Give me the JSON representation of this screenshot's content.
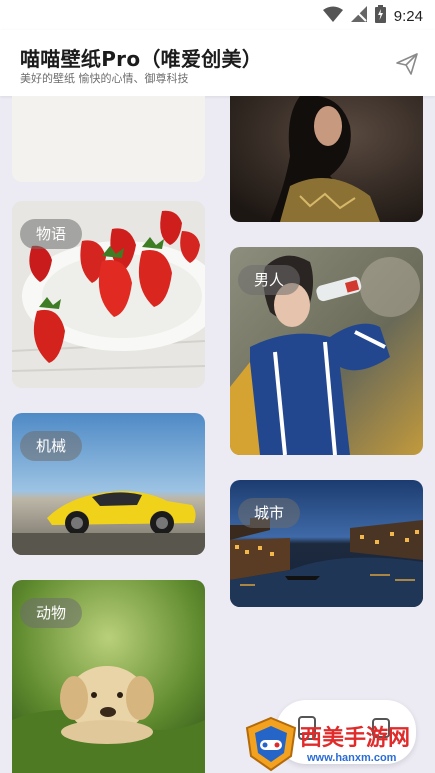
{
  "status_bar": {
    "time": "9:24"
  },
  "header": {
    "title": "喵喵壁纸Pro（唯爱创美）",
    "subtitle": "美好的壁纸 愉快的心情、御尊科技"
  },
  "categories": {
    "strawberry": "物语",
    "man": "男人",
    "car": "机械",
    "city": "城市",
    "dog": "动物"
  },
  "watermark": {
    "brand": "西美手游网",
    "url": "www.hanxm.com"
  }
}
